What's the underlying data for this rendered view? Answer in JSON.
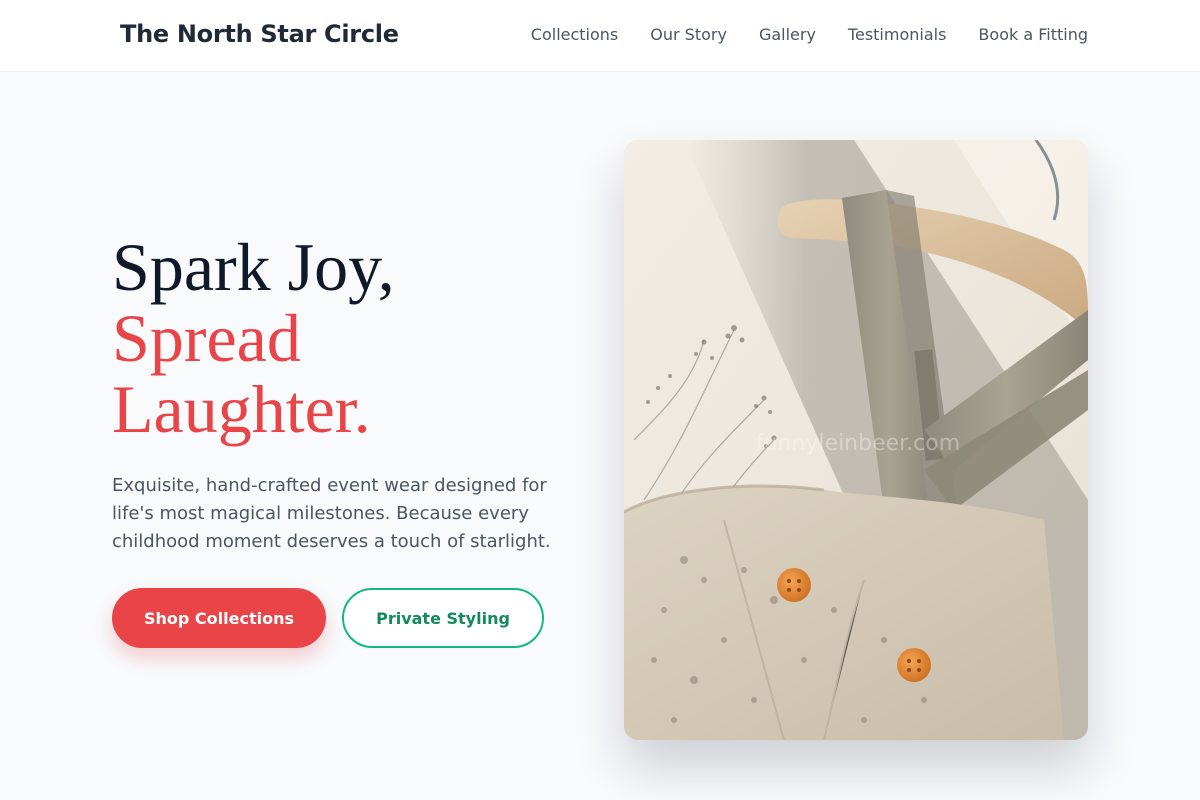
{
  "header": {
    "brand": "The North Star Circle",
    "nav": [
      "Collections",
      "Our Story",
      "Gallery",
      "Testimonials",
      "Book a Fitting"
    ]
  },
  "hero": {
    "title_line1": "Spark Joy,",
    "title_line2": "Spread",
    "title_line3": "Laughter.",
    "description": "Exquisite, hand-crafted event wear designed for life's most magical milestones. Because every childhood moment deserves a touch of starlight.",
    "primary_cta": "Shop Collections",
    "secondary_cta": "Private Styling"
  },
  "image": {
    "watermark": "funnyleinbeer.com"
  },
  "colors": {
    "accent": "#e94548",
    "secondary": "#10b981",
    "text_dark": "#111827",
    "background": "#f8fafc"
  }
}
